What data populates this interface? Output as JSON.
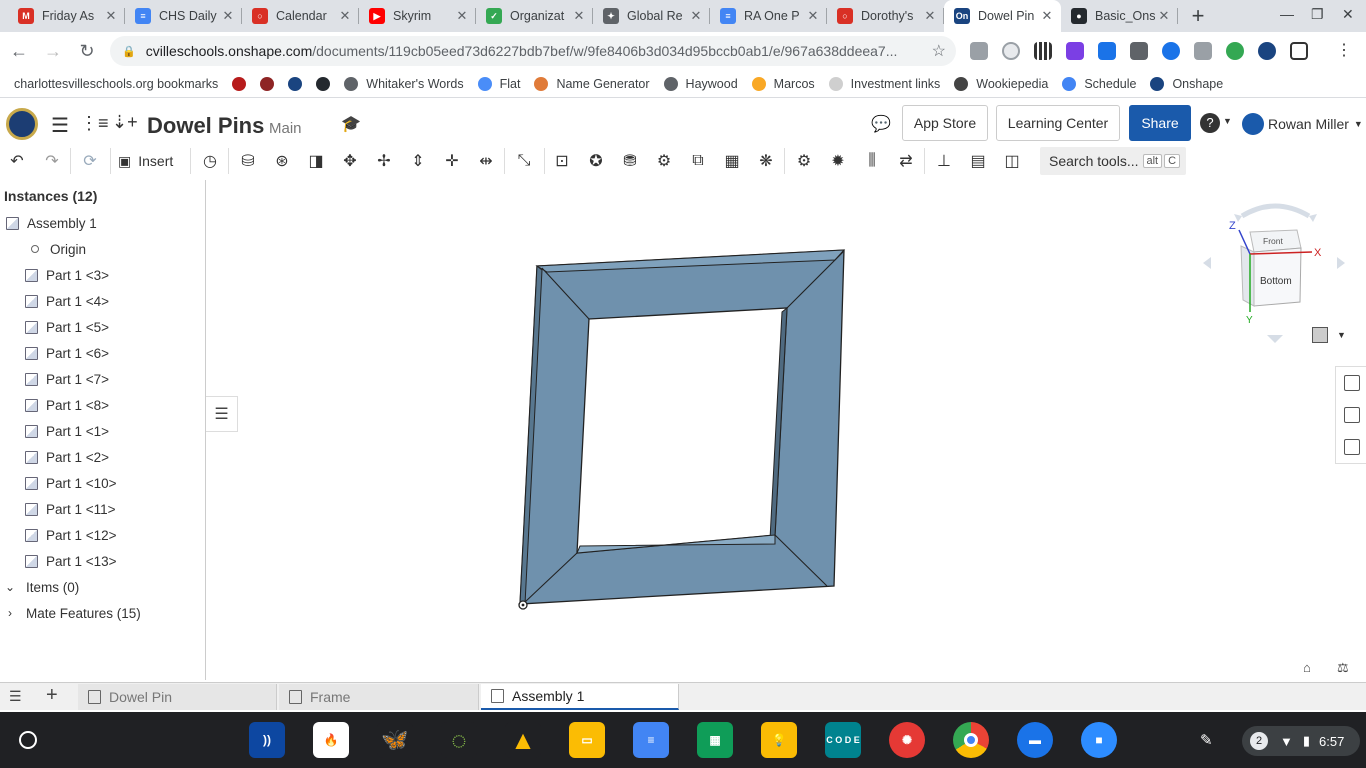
{
  "browser": {
    "tabs": [
      {
        "title": "Friday As",
        "icon": "gmail-icon",
        "color": "#d93025",
        "glyph": "M"
      },
      {
        "title": "CHS Daily",
        "icon": "google-docs-icon",
        "color": "#4285f4",
        "glyph": "≡"
      },
      {
        "title": "Calendar",
        "icon": "calendar-icon",
        "color": "#d93025",
        "glyph": "○"
      },
      {
        "title": "Skyrim",
        "icon": "youtube-icon",
        "color": "#ff0000",
        "glyph": "▶"
      },
      {
        "title": "Organizat",
        "icon": "check-icon",
        "color": "#34a853",
        "glyph": "✓"
      },
      {
        "title": "Global Re",
        "icon": "globe-icon",
        "color": "#5f6368",
        "glyph": "✦"
      },
      {
        "title": "RA One P",
        "icon": "google-docs-icon",
        "color": "#4285f4",
        "glyph": "≡"
      },
      {
        "title": "Dorothy's",
        "icon": "calendar-icon",
        "color": "#d93025",
        "glyph": "○"
      },
      {
        "title": "Dowel Pin",
        "icon": "onshape-icon",
        "color": "#1a4480",
        "glyph": "On",
        "active": true
      },
      {
        "title": "Basic_Ons",
        "icon": "github-icon",
        "color": "#24292e",
        "glyph": "●"
      }
    ],
    "url_host": "cvilleschools.onshape.com",
    "url_path": "/documents/119cb05eed73d6227bdb7bef/w/9fe8406b3d034d95bccb0ab1/e/967a638ddeea7...",
    "bookmarks": [
      {
        "label": "charlottesvilleschools.org bookmarks",
        "color": "#ffffff"
      },
      {
        "label": "",
        "color": "#b71c1c"
      },
      {
        "label": "",
        "color": "#8e2424"
      },
      {
        "label": "",
        "color": "#1a4480"
      },
      {
        "label": "",
        "color": "#24292e"
      },
      {
        "label": "Whitaker's Words",
        "color": "#5f6368"
      },
      {
        "label": "Flat",
        "color": "#4a8df8"
      },
      {
        "label": "Name Generator",
        "color": "#e07b39"
      },
      {
        "label": "Haywood",
        "color": "#5f6368"
      },
      {
        "label": "Marcos",
        "color": "#f9a825"
      },
      {
        "label": "Investment links",
        "color": "#cfcfcf"
      },
      {
        "label": "Wookiepedia",
        "color": "#444"
      },
      {
        "label": "Schedule",
        "color": "#4285f4"
      },
      {
        "label": "Onshape",
        "color": "#1a4480"
      }
    ]
  },
  "onshape": {
    "doc_title": "Dowel Pins",
    "branch": "Main",
    "buttons": {
      "app_store": "App Store",
      "learning_center": "Learning Center",
      "share": "Share"
    },
    "user": "Rowan Miller",
    "toolbar": {
      "insert": "Insert",
      "search": "Search tools...",
      "kbd_alt": "alt",
      "kbd_c": "C"
    },
    "panel": {
      "title": "Instances (12)",
      "assembly": "Assembly 1",
      "origin": "Origin",
      "parts": [
        "Part 1 <3>",
        "Part 1 <4>",
        "Part 1 <5>",
        "Part 1 <6>",
        "Part 1 <7>",
        "Part 1 <8>",
        "Part 1 <1>",
        "Part 1 <2>",
        "Part 1 <10>",
        "Part 1 <11>",
        "Part 1 <12>",
        "Part 1 <13>"
      ],
      "items": "Items (0)",
      "mates": "Mate Features (15)"
    },
    "viewcube": {
      "front": "Front",
      "bottom": "Bottom",
      "x": "X",
      "y": "Y",
      "z": "Z"
    },
    "bottom_tabs": [
      "Dowel Pin",
      "Frame",
      "Assembly 1"
    ],
    "model_color": "#6f91ad"
  },
  "system": {
    "time": "6:57",
    "notifications": "2"
  }
}
